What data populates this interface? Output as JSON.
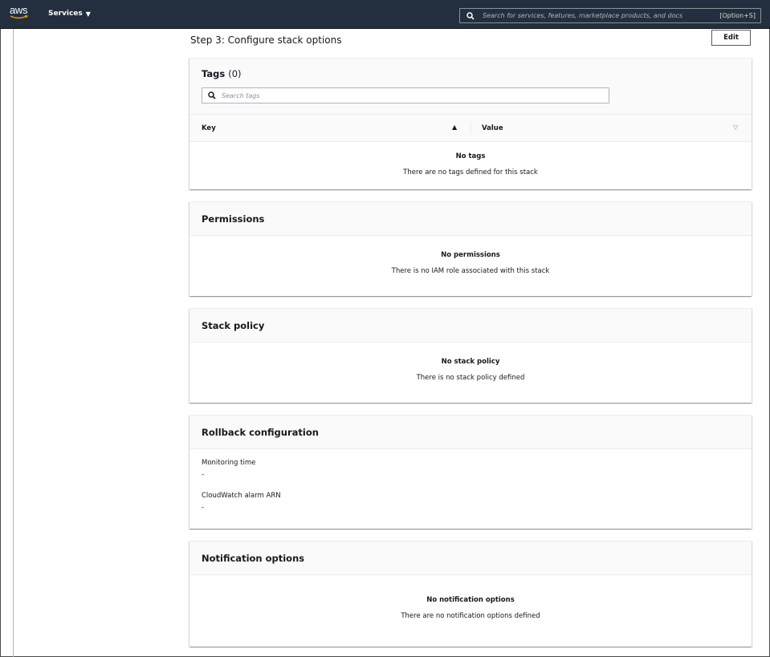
{
  "header": {
    "logo_text": "aws",
    "services_label": "Services",
    "search_placeholder": "Search for services, features, marketplace products, and docs",
    "search_shortcut": "[Option+S]"
  },
  "page": {
    "step_title": "Step 3: Configure stack options",
    "edit_label": "Edit"
  },
  "tags": {
    "title": "Tags",
    "count": "(0)",
    "search_placeholder": "Search tags",
    "columns": {
      "key": "Key",
      "value": "Value"
    },
    "empty_title": "No tags",
    "empty_desc": "There are no tags defined for this stack"
  },
  "permissions": {
    "title": "Permissions",
    "empty_title": "No permissions",
    "empty_desc": "There is no IAM role associated with this stack"
  },
  "stack_policy": {
    "title": "Stack policy",
    "empty_title": "No stack policy",
    "empty_desc": "There is no stack policy defined"
  },
  "rollback": {
    "title": "Rollback configuration",
    "fields": [
      {
        "label": "Monitoring time",
        "value": "-"
      },
      {
        "label": "CloudWatch alarm ARN",
        "value": "-"
      }
    ]
  },
  "notifications": {
    "title": "Notification options",
    "empty_title": "No notification options",
    "empty_desc": "There are no notification options defined"
  },
  "colors": {
    "nav_bg": "#232f3e",
    "panel_header_bg": "#fafafa",
    "text": "#16191f",
    "logo_smile": "#ff9900"
  }
}
